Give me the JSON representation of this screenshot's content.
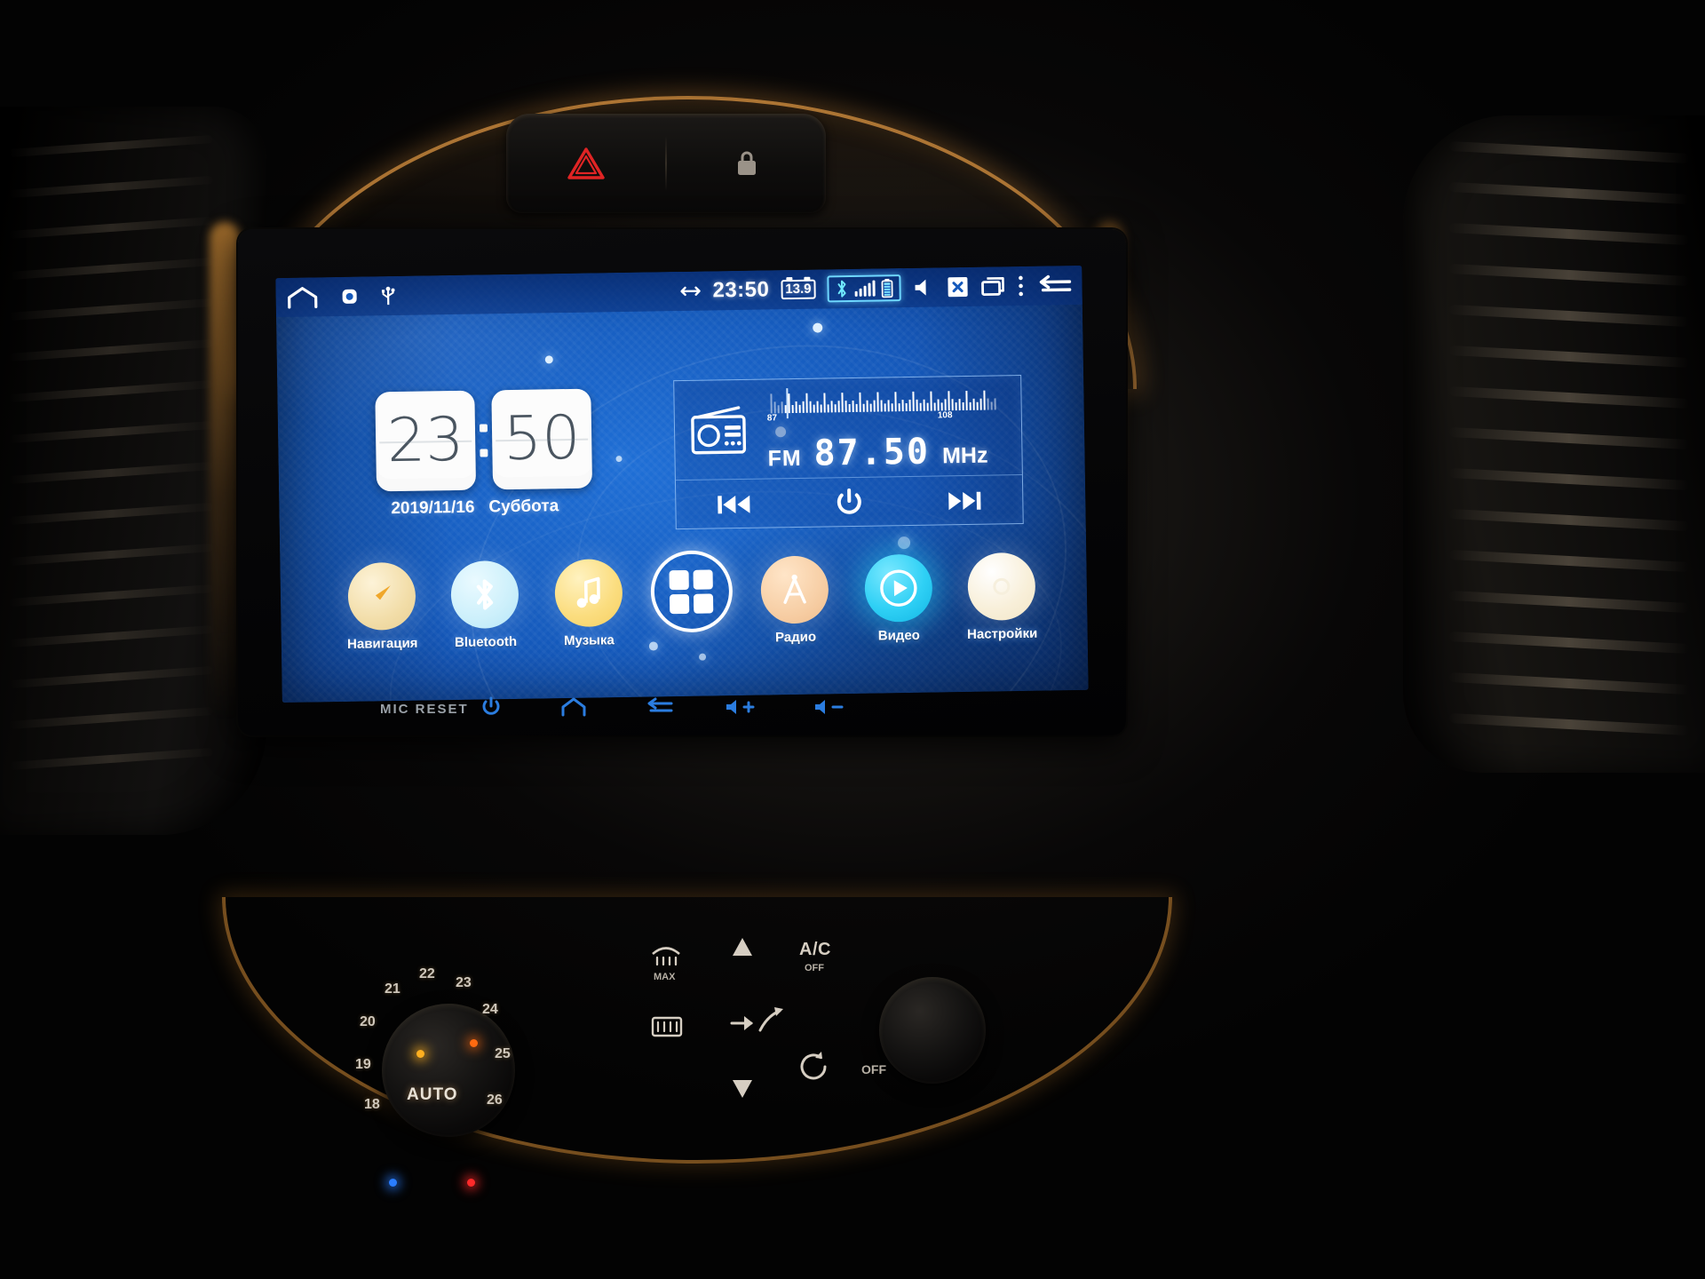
{
  "device": {
    "name": "android-car-head-unit",
    "hazard_button": "hazard-warning",
    "lock_button": "central-lock"
  },
  "statusbar": {
    "home_icon": "home-icon",
    "app_icon": "app-badge-icon",
    "usb_icon": "usb-icon",
    "bidir_icon": "left-right-arrow-icon",
    "clock": "23:50",
    "voltage": "13.9",
    "bluetooth_icon": "bluetooth-icon",
    "signal_icon": "signal-bars-icon",
    "battery_icon": "battery-icon",
    "volume_icon": "volume-icon",
    "close_icon": "close-box-icon",
    "recents_icon": "recents-icon",
    "menu_icon": "overflow-menu-icon",
    "back_icon": "back-arrow-icon",
    "signal_bars": [
      6,
      9,
      12,
      15,
      18
    ]
  },
  "clock_widget": {
    "hours": "23",
    "minutes": "50",
    "date": "2019/11/16",
    "weekday": "Суббота"
  },
  "radio_widget": {
    "icon": "radio-icon",
    "band": "FM",
    "frequency": "87.50",
    "unit": "MHz",
    "scale_min": "87",
    "scale_max": "108",
    "prev_icon": "previous-track-icon",
    "power_icon": "power-icon",
    "next_icon": "next-track-icon"
  },
  "dock": {
    "apps": [
      {
        "label": "Навигация",
        "icon": "compass-icon",
        "color": "#f6e3b4"
      },
      {
        "label": "Bluetooth",
        "icon": "bluetooth-icon",
        "color": "#cdf0fb"
      },
      {
        "label": "Музыка",
        "icon": "music-note-icon",
        "color": "#fbdd7f"
      },
      {
        "label": "",
        "icon": "app-drawer-icon",
        "color": "transparent"
      },
      {
        "label": "Радио",
        "icon": "antenna-icon",
        "color": "#f7cfa6"
      },
      {
        "label": "Видео",
        "icon": "play-icon",
        "color": "#2fd0f5"
      },
      {
        "label": "Настройки",
        "icon": "gear-icon",
        "color": "#f8efd9"
      }
    ]
  },
  "hardkeys": {
    "mic_reset": "MIC  RESET",
    "power": "power-icon",
    "home": "home-icon",
    "back": "back-icon",
    "vol_up": "volume-up-icon",
    "vol_down": "volume-down-icon"
  },
  "climate": {
    "temperatures": [
      "18",
      "19",
      "20",
      "21",
      "22",
      "23",
      "24",
      "25",
      "26"
    ],
    "auto_label": "AUTO",
    "ac_label": "A/C",
    "ac_state": "OFF",
    "rear_defrost_label": "MAX",
    "off_label": "OFF",
    "up_icon": "arrow-up-icon",
    "down_icon": "arrow-down-icon",
    "front_defrost_icon": "front-defrost-icon",
    "rear_defrost_icon": "rear-defrost-icon",
    "airflow_icon": "airflow-mode-icon",
    "recirculate_icon": "recirculate-icon"
  },
  "colors": {
    "screen_blue": "#1559bb",
    "trim_amber": "#de9642",
    "accent_cyan": "#2fd0f5",
    "hazard_red": "#e02020"
  }
}
